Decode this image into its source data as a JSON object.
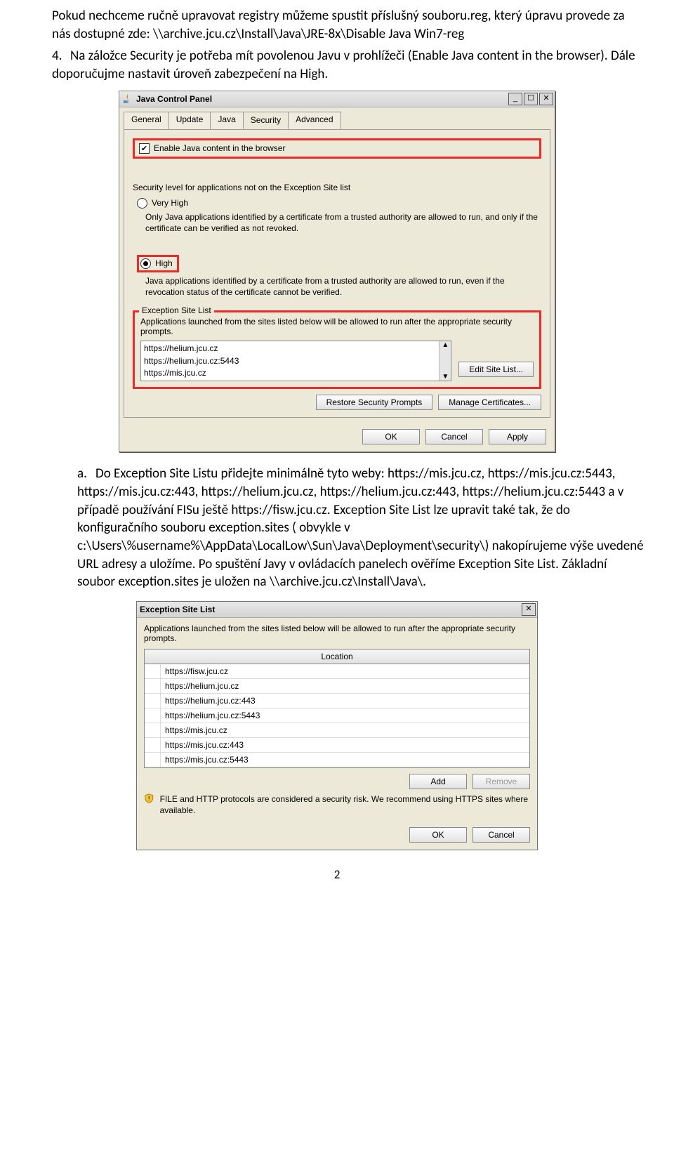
{
  "doc": {
    "p1": "Pokud nechceme ručně upravovat registry můžeme spustit příslušný souboru.reg, který úpravu provede za nás dostupné zde: \\\\archive.jcu.cz\\Install\\Java\\JRE-8x\\Disable Java Win7-reg",
    "num4": "4.",
    "p2": "Na záložce Security je potřeba mít povolenou Javu v prohlížeči (Enable Java content in the browser). Dále doporučujme nastavit úroveň zabezpečení na High.",
    "lettera": "a.",
    "p3": "Do Exception Site Listu přidejte minimálně tyto weby: https://mis.jcu.cz, https://mis.jcu.cz:5443, https://mis.jcu.cz:443, https://helium.jcu.cz, https://helium.jcu.cz:443, https://helium.jcu.cz:5443 a v případě používání FISu ještě https://fisw.jcu.cz. Exception Site List lze upravit také tak, že do konfiguračního souboru exception.sites ( obvykle  v c:\\Users\\%username%\\AppData\\LocalLow\\Sun\\Java\\Deployment\\security\\) nakopírujeme výše uvedené URL adresy a uložíme. Po spuštění Javy v ovládacích panelech ověříme Exception Site List. Základní soubor exception.sites  je uložen na \\\\archive.jcu.cz\\Install\\Java\\.",
    "pagenum": "2"
  },
  "jcp": {
    "title": "Java Control Panel",
    "winbtns": {
      "min": "_",
      "max": "☐",
      "close": "✕"
    },
    "tabs": {
      "general": "General",
      "update": "Update",
      "java": "Java",
      "security": "Security",
      "advanced": "Advanced"
    },
    "enable_label": "Enable Java content in the browser",
    "checkboxmark": "✔",
    "sec_level_title": "Security level for applications not on the Exception Site list",
    "very_high": "Very High",
    "vh_desc": "Only Java applications identified by a certificate from a trusted authority are allowed to run, and only if the certificate can be verified as not revoked.",
    "high": "High",
    "high_desc": "Java applications identified by a certificate from a trusted authority are allowed to run, even if the revocation status of the certificate cannot be verified.",
    "esl_title": "Exception Site List",
    "esl_desc": "Applications launched from the sites listed below will be allowed to run after the appropriate security prompts.",
    "urls": {
      "u1": "https://helium.jcu.cz",
      "u2": "https://helium.jcu.cz:5443",
      "u3": "https://mis.jcu.cz"
    },
    "scroll_up": "▲",
    "scroll_down": "▼",
    "edit_btn": "Edit Site List...",
    "restore_btn": "Restore Security Prompts",
    "manage_btn": "Manage Certificates...",
    "ok": "OK",
    "cancel": "Cancel",
    "apply": "Apply"
  },
  "esl": {
    "title": "Exception Site List",
    "close": "✕",
    "desc": "Applications launched from the sites listed below will be allowed to run after the appropriate security prompts.",
    "colheader": "Location",
    "rows": {
      "r1": "https://fisw.jcu.cz",
      "r2": "https://helium.jcu.cz",
      "r3": "https://helium.jcu.cz:443",
      "r4": "https://helium.jcu.cz:5443",
      "r5": "https://mis.jcu.cz",
      "r6": "https://mis.jcu.cz:443",
      "r7": "https://mis.jcu.cz:5443"
    },
    "add": "Add",
    "remove": "Remove",
    "warn": "FILE and HTTP protocols are considered a security risk. We recommend using HTTPS sites where available.",
    "ok": "OK",
    "cancel": "Cancel"
  }
}
